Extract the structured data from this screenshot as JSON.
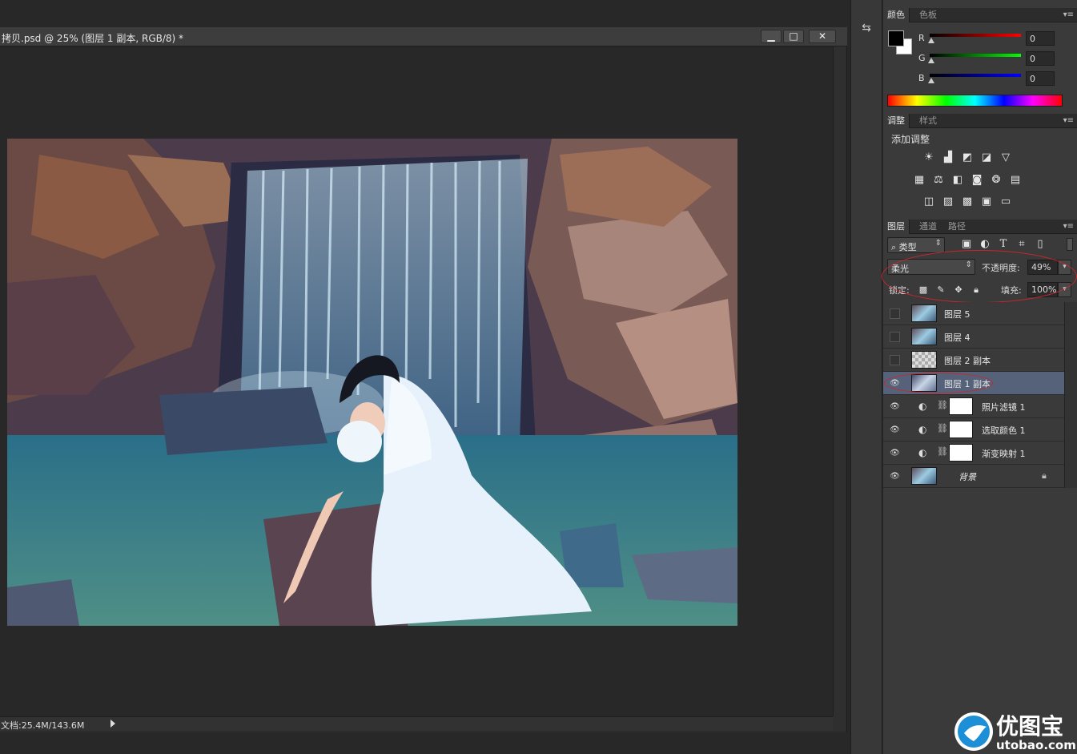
{
  "document": {
    "title": "拷贝.psd @ 25% (图层 1 副本, RGB/8) *",
    "minimize_glyph": "▁",
    "maximize_glyph": "□",
    "close_glyph": "✕",
    "status": "文档:25.4M/143.6M"
  },
  "color_panel": {
    "tabs": [
      "颜色",
      "色板"
    ],
    "channels": [
      {
        "label": "R",
        "value": "0"
      },
      {
        "label": "G",
        "value": "0"
      },
      {
        "label": "B",
        "value": "0"
      }
    ],
    "foreground": "#000000",
    "background": "#ffffff"
  },
  "adjustments_panel": {
    "tabs": [
      "调整",
      "样式"
    ],
    "heading": "添加调整",
    "icons": [
      "brightness-icon",
      "levels-icon",
      "curves-icon",
      "exposure-icon",
      "vibrance-icon",
      "hue-saturation-icon",
      "color-balance-icon",
      "black-white-icon",
      "photo-filter-icon",
      "channel-mixer-icon",
      "color-lookup-icon",
      "invert-icon",
      "posterize-icon",
      "threshold-icon",
      "gradient-map-icon",
      "selective-color-icon"
    ]
  },
  "layers_panel": {
    "tabs": [
      "图层",
      "通道",
      "路径"
    ],
    "filter_label": "类型",
    "blend_mode": "柔光",
    "opacity_label": "不透明度:",
    "opacity_value": "49%",
    "lock_label": "锁定:",
    "fill_label": "填充:",
    "fill_value": "100%",
    "layers": [
      {
        "name": "图层 5",
        "visible": false,
        "kind": "image"
      },
      {
        "name": "图层 4",
        "visible": false,
        "kind": "image"
      },
      {
        "name": "图层 2 副本",
        "visible": false,
        "kind": "transparent"
      },
      {
        "name": "图层 1 副本",
        "visible": true,
        "kind": "image",
        "selected": true
      },
      {
        "name": "照片滤镜 1",
        "visible": true,
        "kind": "adjustment"
      },
      {
        "name": "选取颜色 1",
        "visible": true,
        "kind": "adjustment"
      },
      {
        "name": "渐变映射 1",
        "visible": true,
        "kind": "adjustment"
      },
      {
        "name": "背景",
        "visible": true,
        "kind": "image",
        "locked": true
      }
    ]
  },
  "watermark": {
    "brand": "优图宝",
    "url": "utobao.com"
  },
  "colors": {
    "selection_highlight": "#55627a",
    "annotation_red": "#c8272d",
    "watermark_blue": "#1c8fd6"
  }
}
